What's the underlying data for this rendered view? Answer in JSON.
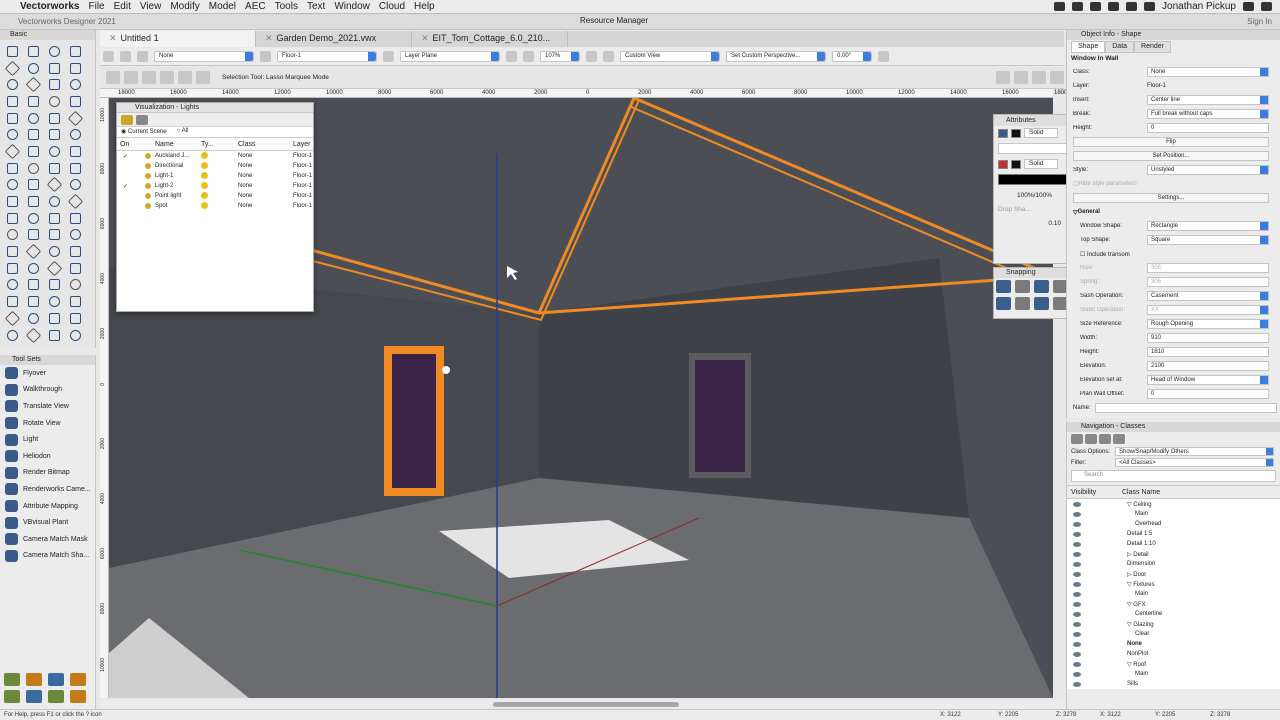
{
  "menubar": {
    "apple": "",
    "app": "Vectorworks",
    "items": [
      "File",
      "Edit",
      "View",
      "Modify",
      "Model",
      "AEC",
      "Tools",
      "Text",
      "Window",
      "Cloud",
      "Help"
    ],
    "user": "Jonathan Pickup"
  },
  "titlebar": {
    "app_title": "Vectorworks Designer 2021",
    "resource_manager": "Resource Manager",
    "sign_in": "Sign In"
  },
  "tabs": [
    {
      "label": "Untitled 1",
      "active": true
    },
    {
      "label": "Garden Demo_2021.vwx",
      "active": false
    },
    {
      "label": "EIT_Tom_Cottage_6.0_210...",
      "active": false
    }
  ],
  "view_bar": {
    "class": "None",
    "layer": "Floor-1",
    "plane": "Layer Plane",
    "zoom": "107%",
    "view": "Custom View",
    "perspective": "Set Custom Perspective...",
    "angle": "0.00°"
  },
  "mode_bar": {
    "hint": "Selection Tool: Lasso Marquee Mode"
  },
  "ruler_top": [
    "18000",
    "16000",
    "14000",
    "12000",
    "10000",
    "8000",
    "6000",
    "4000",
    "2000",
    "0",
    "2000",
    "4000",
    "6000",
    "8000",
    "10000",
    "12000",
    "14000",
    "16000",
    "18000"
  ],
  "ruler_left": [
    "10000",
    "8000",
    "6000",
    "4000",
    "2000",
    "0",
    "2000",
    "4000",
    "6000",
    "8000",
    "10000"
  ],
  "basic_palette": {
    "title": "Basic"
  },
  "tool_sets": {
    "title": "Tool Sets",
    "items": [
      {
        "label": "Flyover",
        "icon": "flyover-icon"
      },
      {
        "label": "Walkthrough",
        "icon": "walkthrough-icon"
      },
      {
        "label": "Translate View",
        "icon": "translate-view-icon"
      },
      {
        "label": "Rotate View",
        "icon": "rotate-view-icon"
      },
      {
        "label": "Light",
        "icon": "light-icon"
      },
      {
        "label": "Heliodon",
        "icon": "heliodon-icon"
      },
      {
        "label": "Render Bitmap",
        "icon": "render-bitmap-icon"
      },
      {
        "label": "Renderworks Came...",
        "icon": "camera-icon"
      },
      {
        "label": "Attribute Mapping",
        "icon": "attribute-mapping-icon"
      },
      {
        "label": "VBvisual Plant",
        "icon": "plant-icon"
      },
      {
        "label": "Camera Match Mask",
        "icon": "camera-match-mask-icon"
      },
      {
        "label": "Camera Match Sha...",
        "icon": "camera-match-shadow-icon"
      }
    ]
  },
  "viz_lights": {
    "title": "Visualization - Lights",
    "radio_current": "Current Scene",
    "radio_all": "All",
    "columns": [
      "On",
      "Name",
      "Ty...",
      "Class",
      "Layer"
    ],
    "rows": [
      {
        "on": "✓",
        "name": "Auckland J...",
        "class": "None",
        "layer": "Floor-1"
      },
      {
        "on": "",
        "name": "Directional",
        "class": "None",
        "layer": "Floor-1"
      },
      {
        "on": "",
        "name": "Light-1",
        "class": "None",
        "layer": "Floor-1"
      },
      {
        "on": "✓",
        "name": "Light-2",
        "class": "None",
        "layer": "Floor-1"
      },
      {
        "on": "",
        "name": "Point light",
        "class": "None",
        "layer": "Floor-1"
      },
      {
        "on": "",
        "name": "Spot",
        "class": "None",
        "layer": "Floor-1"
      }
    ]
  },
  "attributes": {
    "title": "Attributes",
    "fill_style": "Solid",
    "pen_style": "Solid",
    "opacity": "100%/100%",
    "drop_shadow": "Drop Sha...",
    "line_weight": "0.10"
  },
  "snapping": {
    "title": "Snapping"
  },
  "object_info": {
    "title": "Object Info - Shape",
    "tabs": [
      "Shape",
      "Data",
      "Render"
    ],
    "object_title": "Window In Wall",
    "rows": [
      {
        "label": "Class:",
        "value": "None",
        "dd": true
      },
      {
        "label": "Layer:",
        "value": "Floor-1",
        "dd": false,
        "plain": true
      },
      {
        "label": "Insert:",
        "value": "Center line",
        "dd": true
      },
      {
        "label": "Break:",
        "value": "Full break without caps",
        "dd": true
      },
      {
        "label": "Height:",
        "value": "0",
        "dd": false
      }
    ],
    "flip": "Flip",
    "set_position": "Set Position...",
    "style_label": "Style:",
    "style_value": "Unstyled",
    "hide_style": "Hide style parameters",
    "settings": "Settings...",
    "general": "General",
    "general_rows": [
      {
        "label": "Window Shape:",
        "value": "Rectangle",
        "dd": true,
        "dim": false
      },
      {
        "label": "Top Shape:",
        "value": "Square",
        "dd": true,
        "dim": false
      },
      {
        "label": "Include transom",
        "value": "",
        "dd": false,
        "dim": false,
        "check": true
      },
      {
        "label": "Rise:",
        "value": "305",
        "dd": false,
        "dim": true
      },
      {
        "label": "Spring:",
        "value": "305",
        "dd": false,
        "dim": true
      },
      {
        "label": "Sash Operation:",
        "value": "Casement",
        "dd": true,
        "dim": false
      },
      {
        "label": "Slider Operation:",
        "value": "XX",
        "dd": true,
        "dim": true
      },
      {
        "label": "Size Reference:",
        "value": "Rough Opening",
        "dd": true,
        "dim": false
      },
      {
        "label": "Width:",
        "value": "910",
        "dd": false,
        "dim": false
      },
      {
        "label": "Height:",
        "value": "1810",
        "dd": false,
        "dim": false
      },
      {
        "label": "Elevation:",
        "value": "2100",
        "dd": false,
        "dim": false
      },
      {
        "label": "Elevation set at:",
        "value": "Head of Window",
        "dd": true,
        "dim": false
      },
      {
        "label": "Plan Wall Offset:",
        "value": "0",
        "dd": false,
        "dim": false
      }
    ],
    "name_label": "Name:"
  },
  "navigation": {
    "title": "Navigation - Classes",
    "class_options_label": "Class Options:",
    "class_options_value": "Show/Snap/Modify Others",
    "filter_label": "Filter:",
    "filter_value": "<All Classes>",
    "search_placeholder": "Search",
    "col_visibility": "Visibility",
    "col_name": "Class Name",
    "rows": [
      {
        "name": "▽ Ceiling",
        "indent": 2,
        "bold": false
      },
      {
        "name": "Main",
        "indent": 3,
        "bold": false
      },
      {
        "name": "Overhead",
        "indent": 3,
        "bold": false
      },
      {
        "name": "Detail 1:5",
        "indent": 2,
        "bold": false
      },
      {
        "name": "Detail 1:10",
        "indent": 2,
        "bold": false
      },
      {
        "name": "▷ Detail",
        "indent": 2,
        "bold": false
      },
      {
        "name": "Dimension",
        "indent": 2,
        "bold": false
      },
      {
        "name": "▷ Door",
        "indent": 2,
        "bold": false
      },
      {
        "name": "▽ Fixtures",
        "indent": 2,
        "bold": false
      },
      {
        "name": "Main",
        "indent": 3,
        "bold": false
      },
      {
        "name": "▽ GFX",
        "indent": 2,
        "bold": false
      },
      {
        "name": "Centerline",
        "indent": 3,
        "bold": false
      },
      {
        "name": "▽ Glazing",
        "indent": 2,
        "bold": false
      },
      {
        "name": "Clear",
        "indent": 3,
        "bold": false
      },
      {
        "name": "None",
        "indent": 2,
        "bold": true
      },
      {
        "name": "NonPlot",
        "indent": 2,
        "bold": false
      },
      {
        "name": "▽ Roof",
        "indent": 2,
        "bold": false
      },
      {
        "name": "Main",
        "indent": 3,
        "bold": false
      },
      {
        "name": "Sills",
        "indent": 2,
        "bold": false
      }
    ]
  },
  "status": {
    "help": "For Help, press F1 or click the ? icon",
    "coords": [
      "X: 3122",
      "Y: 2205",
      "Z: 3278",
      "X: 3122",
      "Y: 2205",
      "Z: 3278"
    ]
  },
  "colors": {
    "accent": "#3b7de0",
    "selection_orange": "#f08a22",
    "viewport_wall": "#4b4e54"
  }
}
